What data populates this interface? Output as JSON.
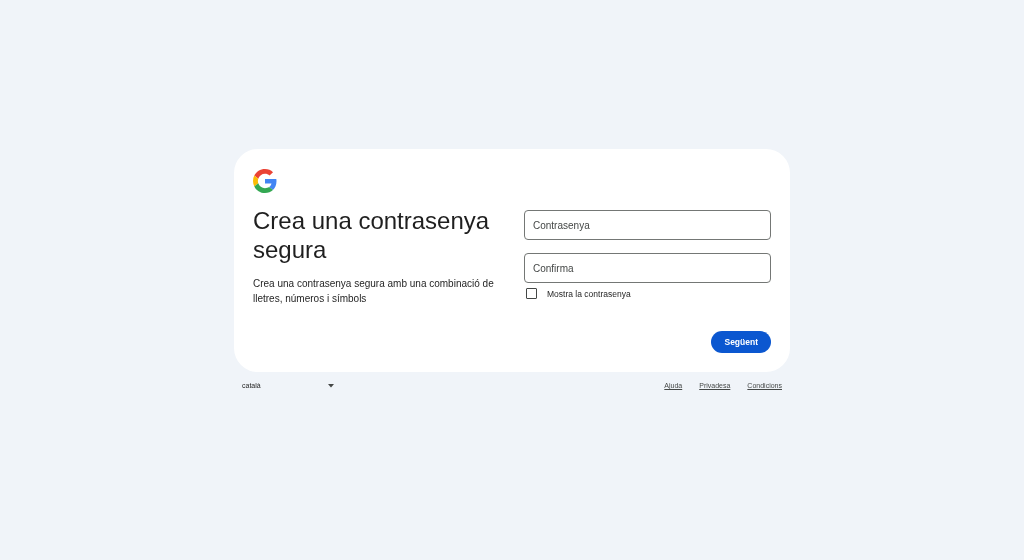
{
  "card": {
    "title": "Crea una contrasenya segura",
    "description": "Crea una contrasenya segura amb una combinació de lletres, números i símbols",
    "fields": [
      {
        "placeholder": "Contrasenya"
      },
      {
        "placeholder": "Confirma"
      }
    ],
    "show_password": {
      "label": "Mostra la contrasenya",
      "checked": false
    },
    "next_button": "Següent"
  },
  "footer": {
    "language": "català",
    "links": [
      "Ajuda",
      "Privadesa",
      "Condicions"
    ]
  }
}
